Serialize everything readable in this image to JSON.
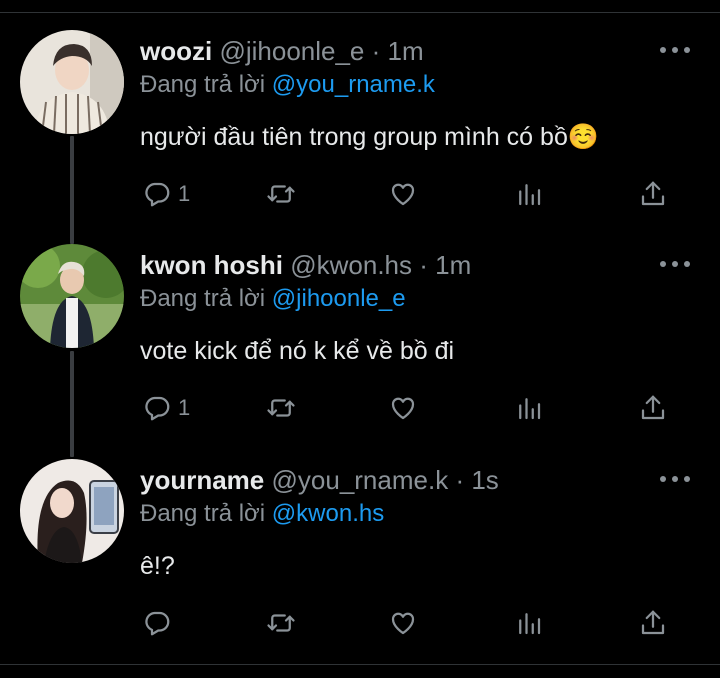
{
  "reply_prefix": "Đang trả lời",
  "colors": {
    "background": "#000000",
    "accent": "#1d9bf0",
    "muted": "#8b9298",
    "text": "#e7e9ea"
  },
  "tweets": [
    {
      "name": "woozi",
      "handle": "@jihoonle_e",
      "separator": "·",
      "time": "1m",
      "reply_to": "@you_rname.k",
      "text": "người đầu tiên trong group mình có bồ☺️",
      "reply_count": "1",
      "avatar": "man-striped-shirt-photo"
    },
    {
      "name": "kwon hoshi",
      "handle": "@kwon.hs",
      "separator": "·",
      "time": "1m",
      "reply_to": "@jihoonle_e",
      "text": "vote kick để nó k kể về bồ đi",
      "reply_count": "1",
      "avatar": "man-outdoor-trees-photo"
    },
    {
      "name": "yourname",
      "handle": "@you_rname.k",
      "separator": "·",
      "time": "1s",
      "reply_to": "@kwon.hs",
      "text": "ê!?",
      "reply_count": "",
      "avatar": "woman-holding-phone-photo"
    }
  ],
  "icons": [
    "more-icon",
    "reply-icon",
    "retweet-icon",
    "like-icon",
    "analytics-icon",
    "share-icon"
  ]
}
